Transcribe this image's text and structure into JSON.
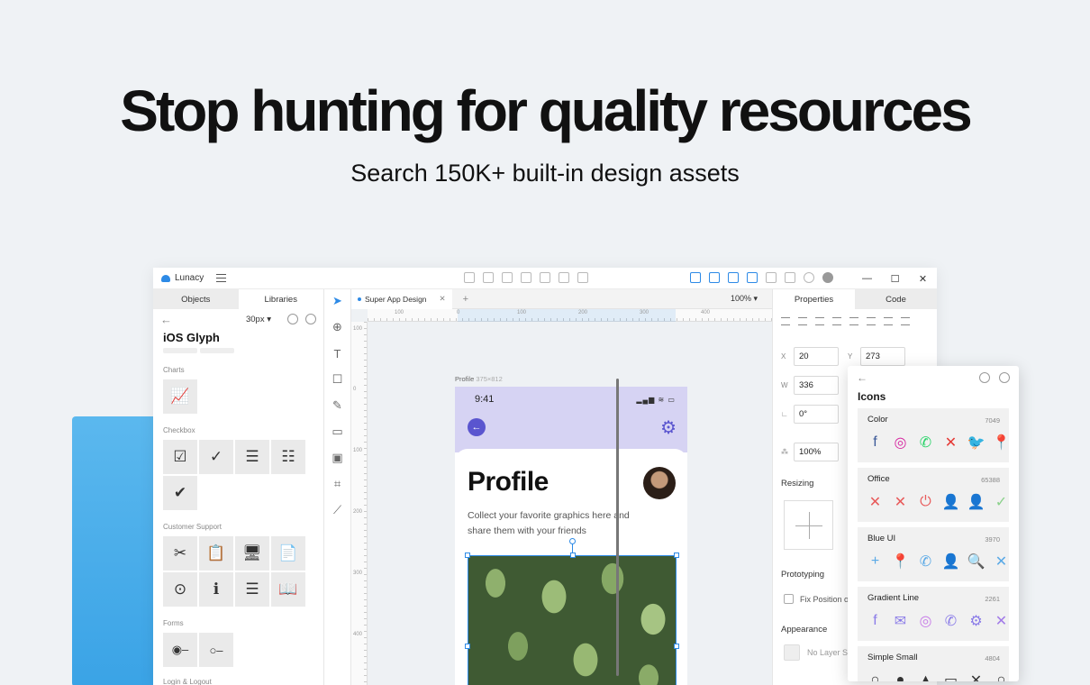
{
  "hero": {
    "title": "Stop hunting for quality resources",
    "subtitle": "Search 150K+ built-in design assets"
  },
  "app": {
    "name": "Lunacy",
    "window_controls": [
      "—",
      "☐",
      "✕"
    ]
  },
  "left_panel": {
    "tabs": [
      "Objects",
      "Libraries"
    ],
    "size": "30px",
    "library_title": "iOS Glyph",
    "sections": [
      {
        "label": "Charts",
        "items": [
          "📈"
        ]
      },
      {
        "label": "Checkbox",
        "items": [
          "☑",
          "✓",
          "☰",
          "☷",
          "✔"
        ]
      },
      {
        "label": "Customer Support",
        "items": [
          "✂",
          "📋",
          "🖥",
          "📄",
          "⊙",
          "ℹ",
          "☰",
          "📖"
        ]
      },
      {
        "label": "Forms",
        "items": [
          "◉–",
          "○–"
        ]
      }
    ],
    "next_section_label": "Login & Logout"
  },
  "canvas": {
    "tab": "Super App Design",
    "zoom": "100%",
    "ruler_h": [
      "100",
      "0",
      "100",
      "200",
      "300",
      "400"
    ],
    "ruler_v": [
      "100",
      "0",
      "100",
      "200",
      "300",
      "400"
    ],
    "frame_name": "Profile",
    "frame_size": "375×812",
    "phone": {
      "time": "9:41",
      "status": "▂▄▆ ≋ ▭",
      "title": "Profile",
      "description": "Collect your favorite graphics here and share them with your friends"
    }
  },
  "properties": {
    "tabs": [
      "Properties",
      "Code"
    ],
    "x": "20",
    "y": "273",
    "w": "336",
    "rotation": "0°",
    "opacity": "100%",
    "labels": {
      "x": "X",
      "y": "Y",
      "w": "W"
    },
    "resizing": "Resizing",
    "prototyping": "Prototyping",
    "fix_position": "Fix Position o",
    "appearance": "Appearance",
    "no_layer_style": "No Layer S"
  },
  "icons_popup": {
    "title": "Icons",
    "categories": [
      {
        "name": "Color",
        "count": "7049",
        "icons": [
          "f",
          "◎",
          "✆",
          "✕",
          "🐦",
          "📍"
        ],
        "colors": [
          "#3b5998",
          "#d6249f",
          "#25d366",
          "#e53935",
          "#1da1f2",
          "#ea4335"
        ]
      },
      {
        "name": "Office",
        "count": "65388",
        "icons": [
          "✕",
          "✕",
          "⏻",
          "👤",
          "👤",
          "✓"
        ],
        "colors": [
          "#e85a5a",
          "#e85a5a",
          "#e85a5a",
          "#f0b04a",
          "#f0b04a",
          "#8bd18b"
        ]
      },
      {
        "name": "Blue UI",
        "count": "3970",
        "icons": [
          "+",
          "📍",
          "✆",
          "👤",
          "🔍",
          "✕"
        ],
        "colors": [
          "#5aa9e6",
          "#5aa9e6",
          "#5aa9e6",
          "#5aa9e6",
          "#5aa9e6",
          "#5aa9e6"
        ]
      },
      {
        "name": "Gradient Line",
        "count": "2261",
        "icons": [
          "f",
          "✉",
          "◎",
          "✆",
          "⚙",
          "✕"
        ],
        "colors": [
          "#8a7be8",
          "#8a7be8",
          "#c77be8",
          "#8a7be8",
          "#8a7be8",
          "#a27be8"
        ]
      },
      {
        "name": "Simple Small",
        "count": "4804",
        "icons": [
          "○",
          "●",
          "▲",
          "▭",
          "✕",
          "○"
        ],
        "colors": [
          "#333333",
          "#333333",
          "#333333",
          "#333333",
          "#333333",
          "#333333"
        ]
      }
    ]
  },
  "colors": {
    "accent": "#2d8ae6",
    "phone_header": "#d6d3f3",
    "phone_accent": "#5a55cf"
  }
}
